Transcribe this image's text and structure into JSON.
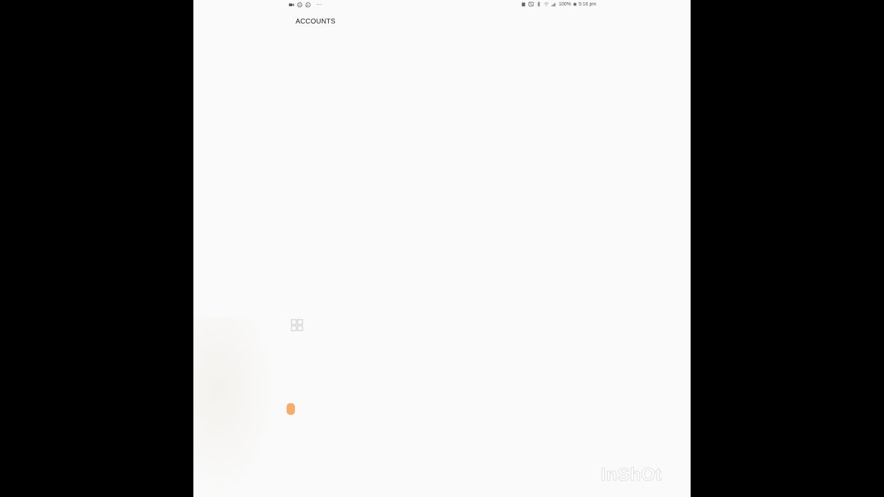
{
  "status_bar": {
    "left_icons": [
      "video-call-icon",
      "smiley-icon",
      "whatsapp-icon"
    ],
    "more": "···",
    "right_icons": [
      "alarm-icon",
      "nfc-icon",
      "bluetooth-icon",
      "wifi-icon",
      "signal-icon"
    ],
    "battery_percent": "100%",
    "time": "5:16 pm"
  },
  "header": {
    "title": "ACCOUNTS"
  },
  "watermark": {
    "text": "InShOt"
  },
  "colors": {
    "screen_background": "#fafafa",
    "accent_orange": "#f5a35a",
    "letterbox": "#000000"
  }
}
